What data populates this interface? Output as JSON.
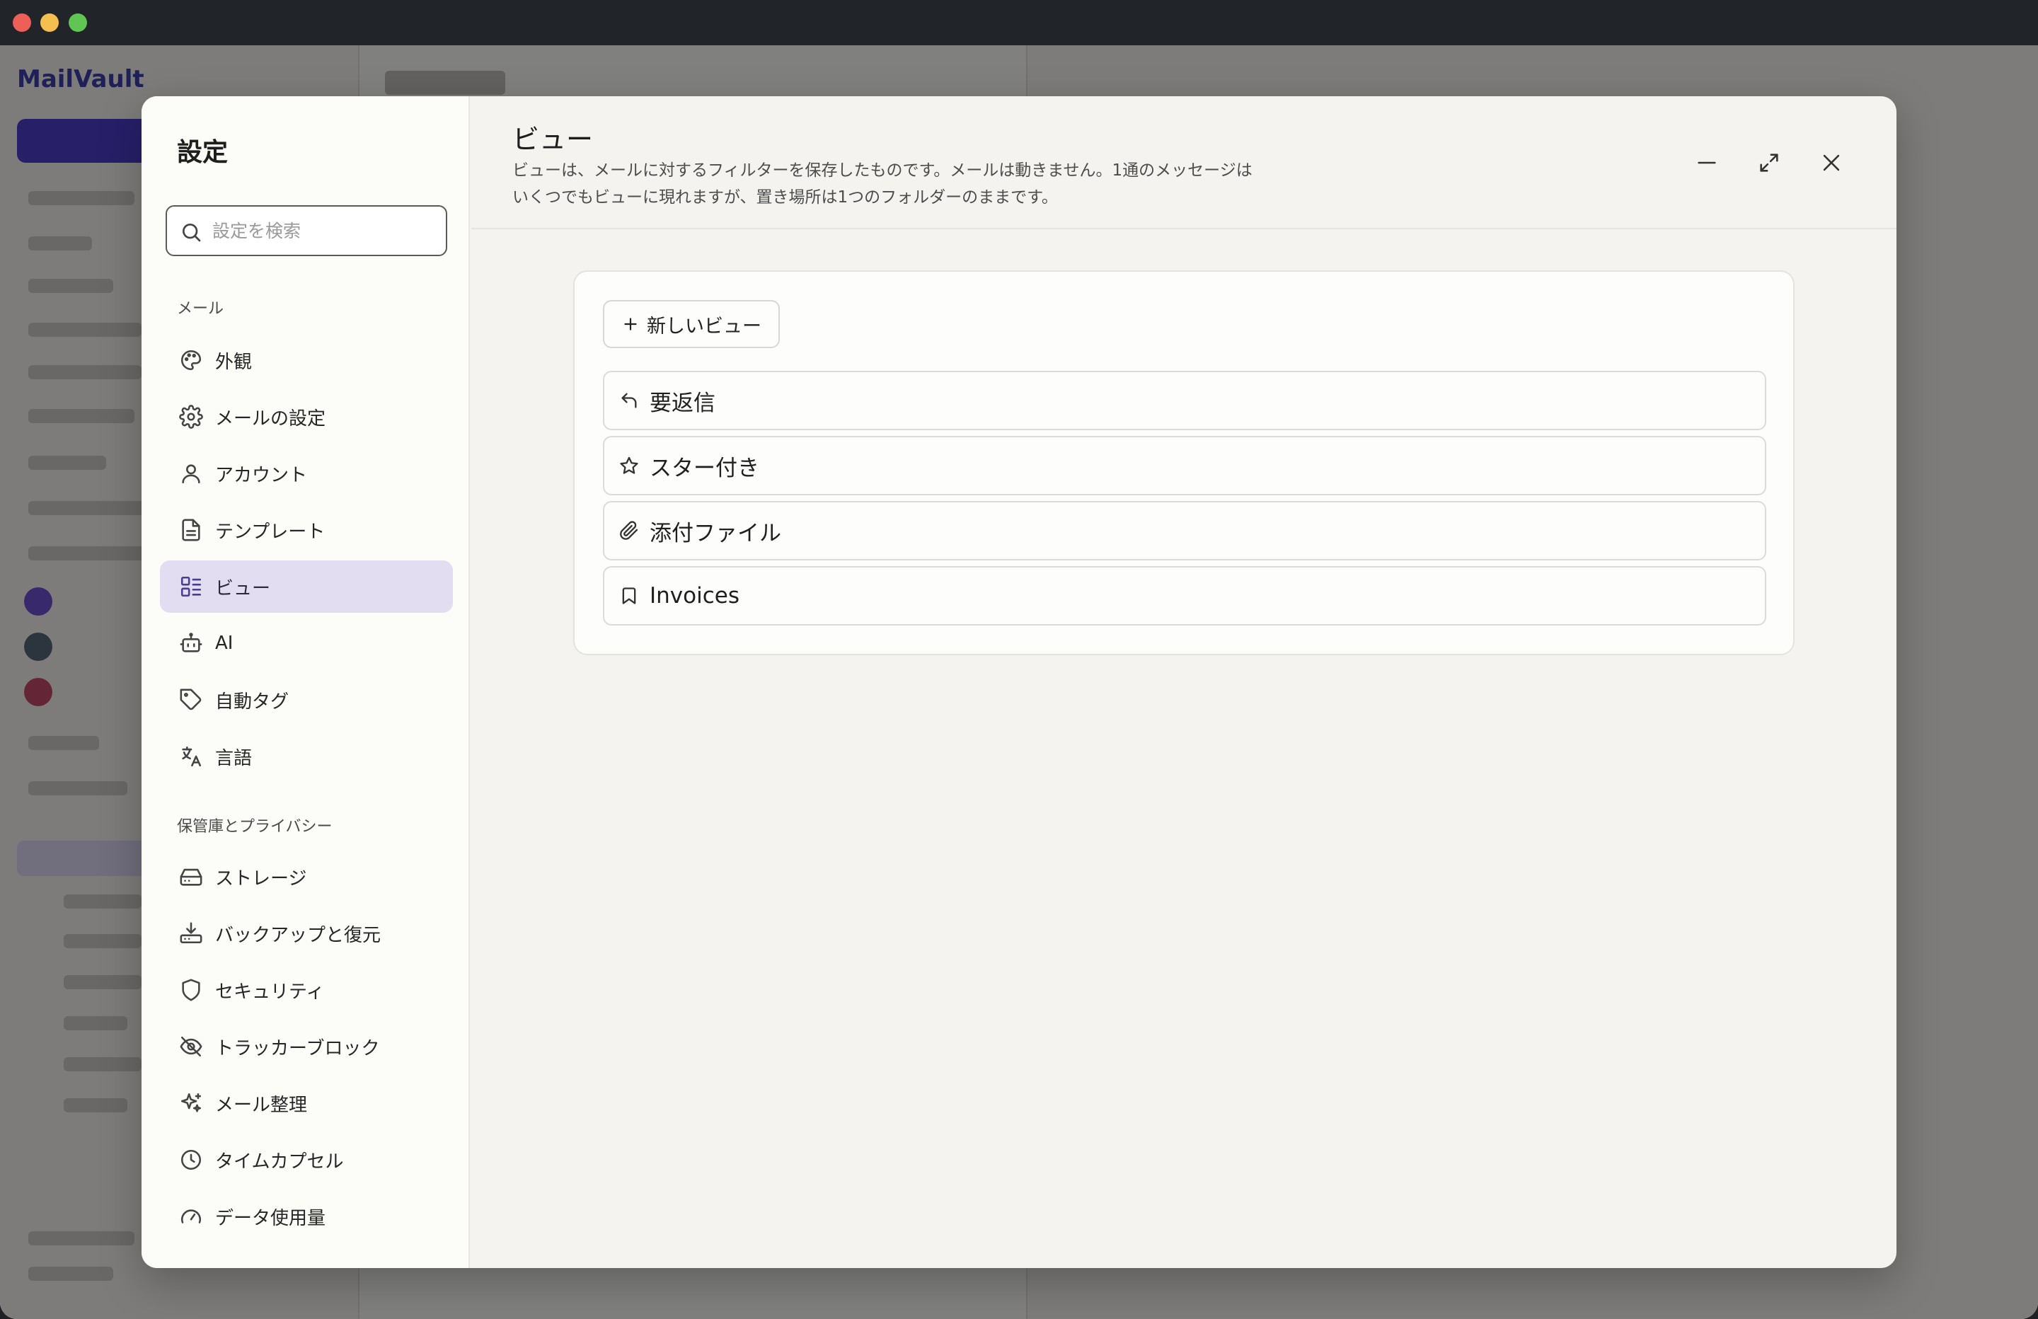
{
  "background_app": {
    "logo_text": "MailVault"
  },
  "settings_modal": {
    "sidebar": {
      "title": "設定",
      "search_placeholder": "設定を検索",
      "sections": [
        {
          "label": "メール",
          "items": [
            {
              "label": "外観",
              "icon": "palette-icon"
            },
            {
              "label": "メールの設定",
              "icon": "gear-icon"
            },
            {
              "label": "アカウント",
              "icon": "user-icon"
            },
            {
              "label": "テンプレート",
              "icon": "document-icon"
            },
            {
              "label": "ビュー",
              "icon": "layout-grid-icon",
              "active": true
            },
            {
              "label": "AI",
              "icon": "bot-icon"
            },
            {
              "label": "自動タグ",
              "icon": "tag-icon"
            },
            {
              "label": "言語",
              "icon": "translate-icon"
            }
          ]
        },
        {
          "label": "保管庫とプライバシー",
          "items": [
            {
              "label": "ストレージ",
              "icon": "hard-drive-icon"
            },
            {
              "label": "バックアップと復元",
              "icon": "download-archive-icon"
            },
            {
              "label": "セキュリティ",
              "icon": "shield-icon"
            },
            {
              "label": "トラッカーブロック",
              "icon": "eye-off-icon"
            },
            {
              "label": "メール整理",
              "icon": "sparkles-icon"
            },
            {
              "label": "タイムカプセル",
              "icon": "clock-icon"
            },
            {
              "label": "データ使用量",
              "icon": "gauge-icon"
            }
          ]
        }
      ]
    },
    "header": {
      "title": "ビュー",
      "description_line1": "ビューは、メールに対するフィルターを保存したものです。メールは動きません。1通のメッセージは",
      "description_line2": "いくつでもビューに現れますが、置き場所は1つのフォルダーのままです。",
      "minimize_icon": "minus-icon",
      "expand_icon": "expand-icon",
      "close_icon": "close-icon"
    },
    "content": {
      "new_view_label": "新しいビュー",
      "views": [
        {
          "label": "要返信",
          "icon": "reply-icon"
        },
        {
          "label": "スター付き",
          "icon": "star-icon"
        },
        {
          "label": "添付ファイル",
          "icon": "paperclip-icon"
        },
        {
          "label": "Invoices",
          "icon": "bookmark-icon"
        }
      ]
    }
  }
}
